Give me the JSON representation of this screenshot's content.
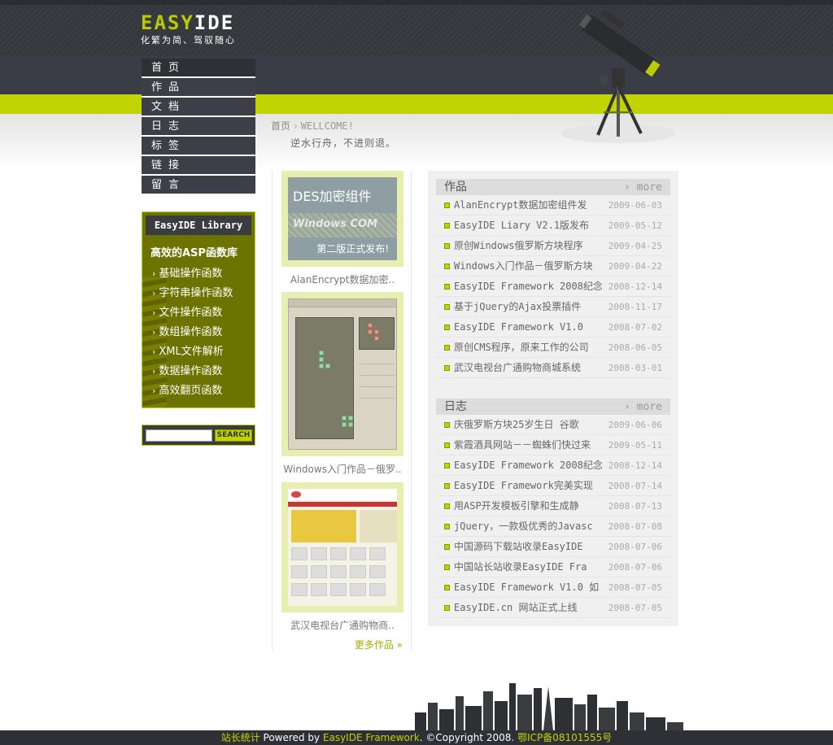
{
  "logo": {
    "part1": "EASY",
    "part2": "IDE",
    "slogan": "化繁为简、驾驭随心"
  },
  "nav": {
    "items": [
      "首页",
      "作品",
      "文档",
      "日志",
      "标签",
      "链接",
      "留言"
    ]
  },
  "breadcrumb": {
    "home": "首页",
    "separator": "›",
    "current": "WELLCOME!"
  },
  "motto": "逆水行舟，不进则退。",
  "library": {
    "title": "EasyIDE Library",
    "subtitle": "高效的ASP函数库",
    "arrow": "›",
    "items": [
      "基础操作函数",
      "字符串操作函数",
      "文件操作函数",
      "数组操作函数",
      "XML文件解析",
      "数据操作函数",
      "高效翻页函数"
    ]
  },
  "search": {
    "placeholder": "",
    "button": "SEARCH"
  },
  "works": {
    "items": [
      {
        "caption": "AlanEncrypt数据加密..",
        "thumb_title": "DES加密组件",
        "thumb_brand": "Windows COM",
        "thumb_sub": "第二版正式发布!"
      },
      {
        "caption": "Windows入门作品－俄罗.."
      },
      {
        "caption": "武汉电视台广通购物商.."
      }
    ],
    "more": "更多作品 »"
  },
  "works_panel": {
    "title": "作品",
    "more": "› more",
    "items": [
      {
        "text": "AlanEncrypt数据加密组件发",
        "date": "2009-06-03"
      },
      {
        "text": "EasyIDE Liary V2.1版发布",
        "date": "2009-05-12"
      },
      {
        "text": "原创Windows俄罗斯方块程序",
        "date": "2009-04-25"
      },
      {
        "text": "Windows入门作品－俄罗斯方块",
        "date": "2009-04-22"
      },
      {
        "text": "EasyIDE Framework 2008纪念",
        "date": "2008-12-14"
      },
      {
        "text": "基于jQuery的Ajax投票插件",
        "date": "2008-11-17"
      },
      {
        "text": "EasyIDE Framework V1.0",
        "date": "2008-07-02"
      },
      {
        "text": "原创CMS程序，原来工作的公司",
        "date": "2008-06-05"
      },
      {
        "text": "武汉电视台广通购物商城系统",
        "date": "2008-03-01"
      }
    ]
  },
  "blog_panel": {
    "title": "日志",
    "more": "› more",
    "items": [
      {
        "text": "庆俄罗斯方块25岁生日 谷歌",
        "date": "2009-06-06"
      },
      {
        "text": "紫霞酒具网站－－蜘蛛们快过来",
        "date": "2009-05-11"
      },
      {
        "text": "EasyIDE Framework 2008纪念",
        "date": "2008-12-14"
      },
      {
        "text": "EasyIDE Framework完美实现",
        "date": "2008-07-14"
      },
      {
        "text": "用ASP开发模板引擎和生成静",
        "date": "2008-07-13"
      },
      {
        "text": "jQuery，一款极优秀的Javasc",
        "date": "2008-07-08"
      },
      {
        "text": "中国源码下载站收录EasyIDE",
        "date": "2008-07-06"
      },
      {
        "text": "中国站长站收录EasyIDE Fra",
        "date": "2008-07-06"
      },
      {
        "text": "EasyIDE Framework V1.0 如",
        "date": "2008-07-05"
      },
      {
        "text": "EasyIDE.cn 网站正式上线",
        "date": "2008-07-05"
      }
    ]
  },
  "footer": {
    "stats": "站长统计",
    "powered": " Powered by ",
    "framework": "EasyIDE Framework",
    "copyright": ". ©Copyright 2008.",
    "icp": "鄂ICP备08101555号"
  },
  "colors": {
    "accent": "#c2d400",
    "dark": "#3a3d45",
    "library_bg": "#6d7300"
  }
}
